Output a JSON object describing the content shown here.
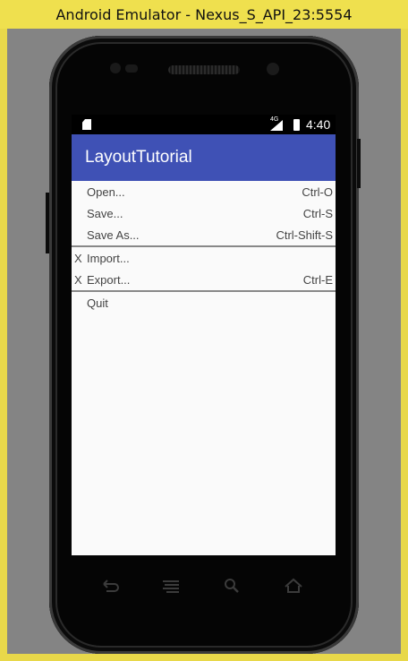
{
  "window": {
    "title": "Android Emulator - Nexus_S_API_23:5554"
  },
  "statusbar": {
    "network": "4G",
    "time": "4:40"
  },
  "appbar": {
    "title": "LayoutTutorial"
  },
  "menu": {
    "groups": [
      [
        {
          "mark": "",
          "label": "Open...",
          "shortcut": "Ctrl-O"
        },
        {
          "mark": "",
          "label": "Save...",
          "shortcut": "Ctrl-S"
        },
        {
          "mark": "",
          "label": "Save As...",
          "shortcut": "Ctrl-Shift-S"
        }
      ],
      [
        {
          "mark": "X",
          "label": "Import...",
          "shortcut": ""
        },
        {
          "mark": "X",
          "label": "Export...",
          "shortcut": "Ctrl-E"
        }
      ],
      [
        {
          "mark": "",
          "label": "Quit",
          "shortcut": ""
        }
      ]
    ]
  },
  "navbar": {
    "icons": [
      "back-icon",
      "recents-icon",
      "search-icon",
      "home-icon"
    ]
  },
  "colors": {
    "appbar": "#3f51b5",
    "frame": "#e8d84a",
    "emulator_bg": "#848484"
  }
}
